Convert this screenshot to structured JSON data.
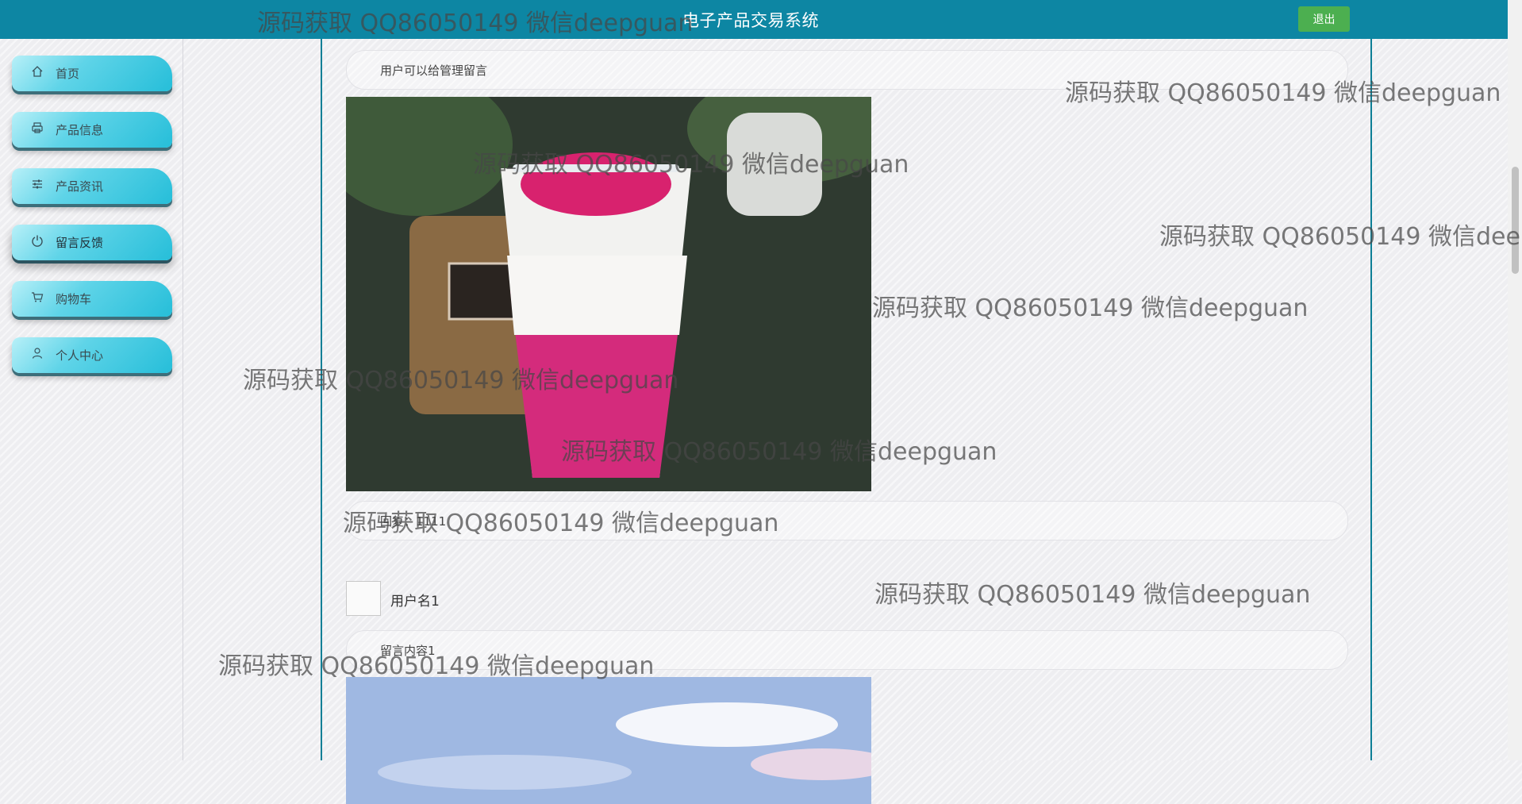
{
  "header": {
    "title": "电子产品交易系统",
    "logout_label": "退出"
  },
  "sidebar": {
    "items": [
      {
        "label": "首页",
        "icon": "home-icon"
      },
      {
        "label": "产品信息",
        "icon": "printer-icon"
      },
      {
        "label": "产品资讯",
        "icon": "sliders-icon"
      },
      {
        "label": "留言反馈",
        "icon": "power-icon",
        "active": true
      },
      {
        "label": "购物车",
        "icon": "cart-icon"
      },
      {
        "label": "个人中心",
        "icon": "user-icon"
      }
    ]
  },
  "messages": {
    "intro": "用户可以给管理留言",
    "reply1": "回复：1111",
    "user_name": "用户名1",
    "content1": "留言内容1"
  },
  "watermark": "源码获取 QQ86050149 微信deepguan",
  "colors": {
    "header_bg": "#0d86a3",
    "logout_bg": "#4caf50",
    "sidebar_button": "#26bed9",
    "content_border": "#0d7f96"
  }
}
